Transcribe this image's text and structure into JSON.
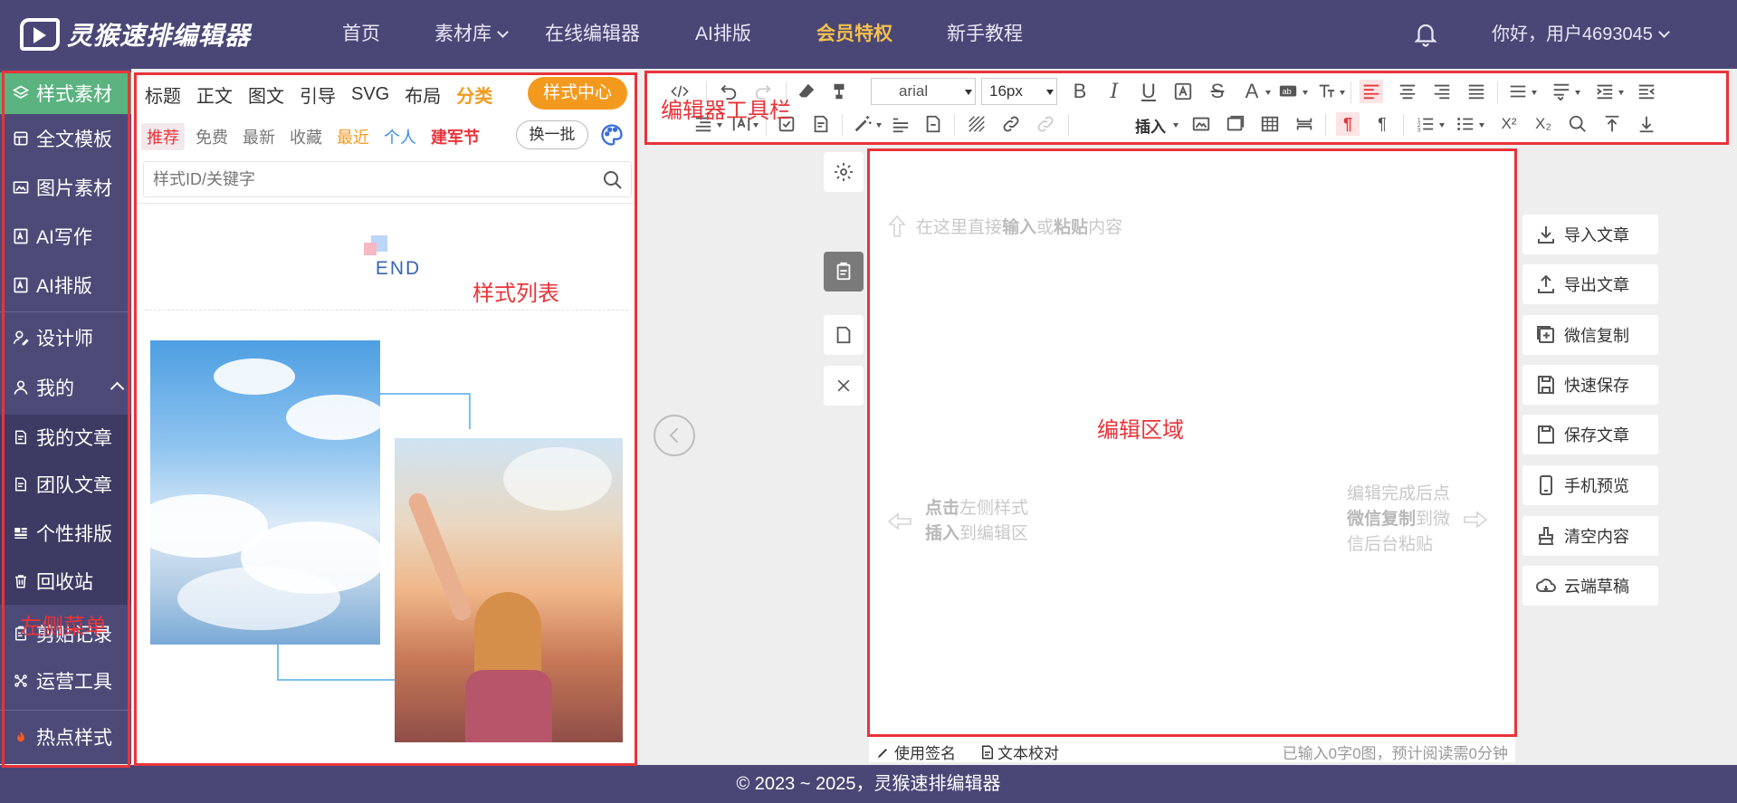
{
  "header": {
    "brand": "灵猴速排编辑器",
    "nav": [
      {
        "label": "首页"
      },
      {
        "label": "素材库"
      },
      {
        "label": "在线编辑器"
      },
      {
        "label": "AI排版"
      },
      {
        "label": "会员特权"
      },
      {
        "label": "新手教程"
      }
    ],
    "user_greeting": "你好，用户4693045"
  },
  "sidebar": {
    "items": [
      {
        "label": "样式素材",
        "icon": "layers-icon",
        "active": true
      },
      {
        "label": "全文模板",
        "icon": "template-icon"
      },
      {
        "label": "图片素材",
        "icon": "image-icon"
      },
      {
        "label": "AI写作",
        "icon": "ai-write-icon"
      },
      {
        "label": "AI排版",
        "icon": "ai-layout-icon"
      },
      {
        "label": "设计师",
        "icon": "designer-icon"
      },
      {
        "label": "我的",
        "icon": "user-icon"
      },
      {
        "label": "我的文章",
        "icon": "article-icon"
      },
      {
        "label": "团队文章",
        "icon": "team-article-icon"
      },
      {
        "label": "个性排版",
        "icon": "custom-layout-icon"
      },
      {
        "label": "回收站",
        "icon": "trash-icon"
      },
      {
        "label": "剪贴记录",
        "icon": "clipboard-icon"
      },
      {
        "label": "运营工具",
        "icon": "tools-icon"
      },
      {
        "label": "热点样式",
        "icon": "fire-icon"
      }
    ]
  },
  "style_panel": {
    "tabs": [
      "标题",
      "正文",
      "图文",
      "引导",
      "SVG",
      "布局",
      "分类"
    ],
    "style_center": "样式中心",
    "filters": [
      "推荐",
      "免费",
      "最新",
      "收藏",
      "最近",
      "个人",
      "建军节"
    ],
    "swap_button": "换一批",
    "search_placeholder": "样式ID/关键字",
    "end_text": "END"
  },
  "toolbar": {
    "font_family": "arial",
    "font_size": "16px",
    "insert_label": "插入"
  },
  "editor": {
    "hint_top_1": "在这里直接",
    "hint_top_2": "输入",
    "hint_top_3": "或",
    "hint_top_4": "粘贴",
    "hint_top_5": "内容",
    "hint_left_1": "点击",
    "hint_left_2": "左侧样式",
    "hint_left_3": "插入",
    "hint_left_4": "到编辑区",
    "hint_right_1": "编辑完成后点",
    "hint_right_2": "微信复制",
    "hint_right_3": "到微",
    "hint_right_4": "信后台粘贴"
  },
  "status_bar": {
    "signature": "使用签名",
    "proofread": "文本校对",
    "count": "已输入0字0图，预计阅读需0分钟"
  },
  "right_actions": [
    {
      "label": "导入文章",
      "icon": "import-icon"
    },
    {
      "label": "导出文章",
      "icon": "export-icon"
    },
    {
      "label": "微信复制",
      "icon": "wechat-copy-icon"
    },
    {
      "label": "快速保存",
      "icon": "quick-save-icon"
    },
    {
      "label": "保存文章",
      "icon": "save-icon"
    },
    {
      "label": "手机预览",
      "icon": "phone-icon"
    },
    {
      "label": "清空内容",
      "icon": "clear-icon"
    },
    {
      "label": "云端草稿",
      "icon": "cloud-icon"
    }
  ],
  "footer": {
    "copyright": "© 2023 ~ 2025，灵猴速排编辑器"
  },
  "annotations": {
    "left_menu": "左侧菜单",
    "style_list": "样式列表",
    "toolbar": "编辑器工具栏",
    "edit_area": "编辑区域"
  },
  "colors": {
    "header_bg": "#4a4676",
    "sidebar_bg": "#4d4a78",
    "active_green": "#5bb37f",
    "accent_orange": "#f39a1e",
    "annotation_red": "#e8343a"
  }
}
